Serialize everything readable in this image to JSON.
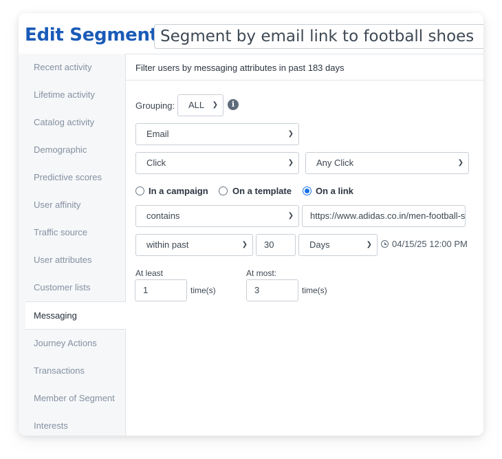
{
  "header": {
    "title": "Edit Segment:",
    "segment_name": "Segment by email link to football shoes"
  },
  "sidebar": {
    "items": [
      {
        "label": "Recent activity"
      },
      {
        "label": "Lifetime activity"
      },
      {
        "label": "Catalog activity"
      },
      {
        "label": "Demographic"
      },
      {
        "label": "Predictive scores"
      },
      {
        "label": "User affinity"
      },
      {
        "label": "Traffic source"
      },
      {
        "label": "User attributes"
      },
      {
        "label": "Customer lists"
      },
      {
        "label": "Messaging",
        "active": true
      },
      {
        "label": "Journey Actions"
      },
      {
        "label": "Transactions"
      },
      {
        "label": "Member of Segment"
      },
      {
        "label": "Interests"
      }
    ]
  },
  "filter": {
    "header": "Filter users by messaging attributes in past 183 days",
    "grouping_label": "Grouping:",
    "grouping_value": "ALL",
    "channel": "Email",
    "event": "Click",
    "click_type": "Any Click",
    "target_options": [
      {
        "label": "In a campaign",
        "checked": false
      },
      {
        "label": "On a template",
        "checked": false
      },
      {
        "label": "On a link",
        "checked": true
      }
    ],
    "match_operator": "contains",
    "link_value": "https://www.adidas.co.in/men-football-shoes",
    "time_operator": "within past",
    "time_amount": "30",
    "time_unit": "Days",
    "timestamp": "04/15/25 12:00 PM",
    "at_least_label": "At least",
    "at_least_value": "1",
    "at_most_label": "At most:",
    "at_most_value": "3",
    "times_label": "time(s)"
  },
  "icons": {
    "info": "info-icon",
    "clock": "clock-icon",
    "dropdown": "chevron-down-icon"
  },
  "colors": {
    "title": "#1a5bb8",
    "radio_checked": "#1670e6",
    "sidebar_bg": "#f5f7f9"
  }
}
